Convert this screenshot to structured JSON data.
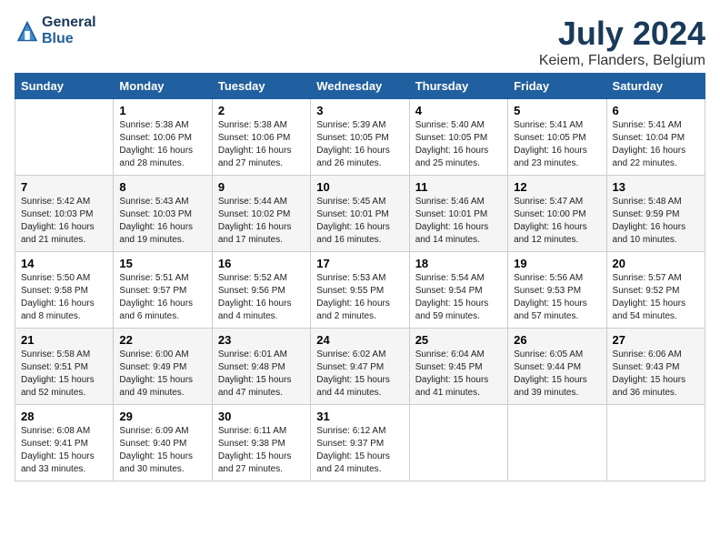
{
  "logo": {
    "line1": "General",
    "line2": "Blue"
  },
  "title": "July 2024",
  "subtitle": "Keiem, Flanders, Belgium",
  "days_of_week": [
    "Sunday",
    "Monday",
    "Tuesday",
    "Wednesday",
    "Thursday",
    "Friday",
    "Saturday"
  ],
  "weeks": [
    [
      {
        "day": "",
        "info": ""
      },
      {
        "day": "1",
        "info": "Sunrise: 5:38 AM\nSunset: 10:06 PM\nDaylight: 16 hours\nand 28 minutes."
      },
      {
        "day": "2",
        "info": "Sunrise: 5:38 AM\nSunset: 10:06 PM\nDaylight: 16 hours\nand 27 minutes."
      },
      {
        "day": "3",
        "info": "Sunrise: 5:39 AM\nSunset: 10:05 PM\nDaylight: 16 hours\nand 26 minutes."
      },
      {
        "day": "4",
        "info": "Sunrise: 5:40 AM\nSunset: 10:05 PM\nDaylight: 16 hours\nand 25 minutes."
      },
      {
        "day": "5",
        "info": "Sunrise: 5:41 AM\nSunset: 10:05 PM\nDaylight: 16 hours\nand 23 minutes."
      },
      {
        "day": "6",
        "info": "Sunrise: 5:41 AM\nSunset: 10:04 PM\nDaylight: 16 hours\nand 22 minutes."
      }
    ],
    [
      {
        "day": "7",
        "info": "Sunrise: 5:42 AM\nSunset: 10:03 PM\nDaylight: 16 hours\nand 21 minutes."
      },
      {
        "day": "8",
        "info": "Sunrise: 5:43 AM\nSunset: 10:03 PM\nDaylight: 16 hours\nand 19 minutes."
      },
      {
        "day": "9",
        "info": "Sunrise: 5:44 AM\nSunset: 10:02 PM\nDaylight: 16 hours\nand 17 minutes."
      },
      {
        "day": "10",
        "info": "Sunrise: 5:45 AM\nSunset: 10:01 PM\nDaylight: 16 hours\nand 16 minutes."
      },
      {
        "day": "11",
        "info": "Sunrise: 5:46 AM\nSunset: 10:01 PM\nDaylight: 16 hours\nand 14 minutes."
      },
      {
        "day": "12",
        "info": "Sunrise: 5:47 AM\nSunset: 10:00 PM\nDaylight: 16 hours\nand 12 minutes."
      },
      {
        "day": "13",
        "info": "Sunrise: 5:48 AM\nSunset: 9:59 PM\nDaylight: 16 hours\nand 10 minutes."
      }
    ],
    [
      {
        "day": "14",
        "info": "Sunrise: 5:50 AM\nSunset: 9:58 PM\nDaylight: 16 hours\nand 8 minutes."
      },
      {
        "day": "15",
        "info": "Sunrise: 5:51 AM\nSunset: 9:57 PM\nDaylight: 16 hours\nand 6 minutes."
      },
      {
        "day": "16",
        "info": "Sunrise: 5:52 AM\nSunset: 9:56 PM\nDaylight: 16 hours\nand 4 minutes."
      },
      {
        "day": "17",
        "info": "Sunrise: 5:53 AM\nSunset: 9:55 PM\nDaylight: 16 hours\nand 2 minutes."
      },
      {
        "day": "18",
        "info": "Sunrise: 5:54 AM\nSunset: 9:54 PM\nDaylight: 15 hours\nand 59 minutes."
      },
      {
        "day": "19",
        "info": "Sunrise: 5:56 AM\nSunset: 9:53 PM\nDaylight: 15 hours\nand 57 minutes."
      },
      {
        "day": "20",
        "info": "Sunrise: 5:57 AM\nSunset: 9:52 PM\nDaylight: 15 hours\nand 54 minutes."
      }
    ],
    [
      {
        "day": "21",
        "info": "Sunrise: 5:58 AM\nSunset: 9:51 PM\nDaylight: 15 hours\nand 52 minutes."
      },
      {
        "day": "22",
        "info": "Sunrise: 6:00 AM\nSunset: 9:49 PM\nDaylight: 15 hours\nand 49 minutes."
      },
      {
        "day": "23",
        "info": "Sunrise: 6:01 AM\nSunset: 9:48 PM\nDaylight: 15 hours\nand 47 minutes."
      },
      {
        "day": "24",
        "info": "Sunrise: 6:02 AM\nSunset: 9:47 PM\nDaylight: 15 hours\nand 44 minutes."
      },
      {
        "day": "25",
        "info": "Sunrise: 6:04 AM\nSunset: 9:45 PM\nDaylight: 15 hours\nand 41 minutes."
      },
      {
        "day": "26",
        "info": "Sunrise: 6:05 AM\nSunset: 9:44 PM\nDaylight: 15 hours\nand 39 minutes."
      },
      {
        "day": "27",
        "info": "Sunrise: 6:06 AM\nSunset: 9:43 PM\nDaylight: 15 hours\nand 36 minutes."
      }
    ],
    [
      {
        "day": "28",
        "info": "Sunrise: 6:08 AM\nSunset: 9:41 PM\nDaylight: 15 hours\nand 33 minutes."
      },
      {
        "day": "29",
        "info": "Sunrise: 6:09 AM\nSunset: 9:40 PM\nDaylight: 15 hours\nand 30 minutes."
      },
      {
        "day": "30",
        "info": "Sunrise: 6:11 AM\nSunset: 9:38 PM\nDaylight: 15 hours\nand 27 minutes."
      },
      {
        "day": "31",
        "info": "Sunrise: 6:12 AM\nSunset: 9:37 PM\nDaylight: 15 hours\nand 24 minutes."
      },
      {
        "day": "",
        "info": ""
      },
      {
        "day": "",
        "info": ""
      },
      {
        "day": "",
        "info": ""
      }
    ]
  ]
}
